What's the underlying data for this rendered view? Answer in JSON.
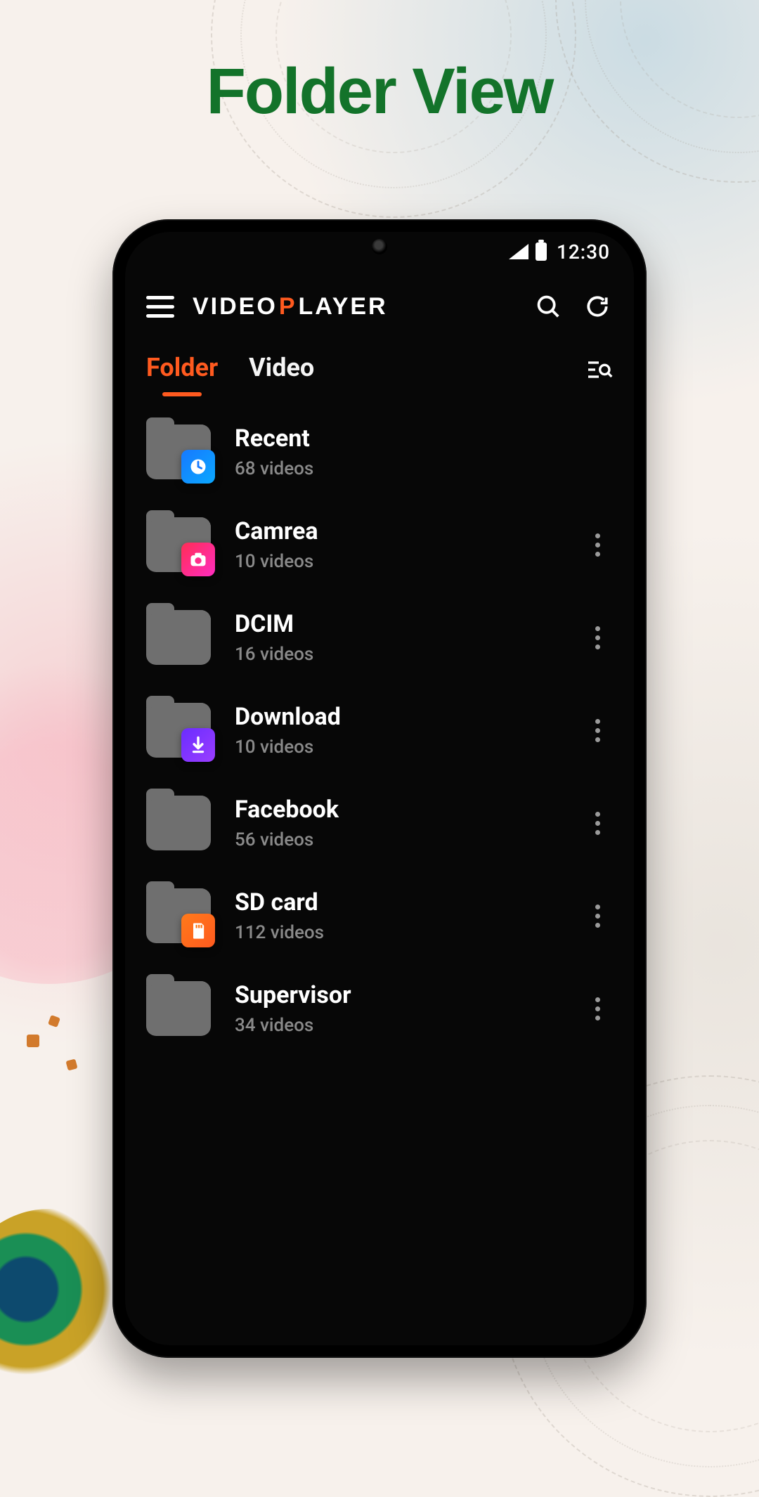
{
  "headline": "Folder View",
  "statusbar": {
    "time": "12:30"
  },
  "app": {
    "title_prefix": "VIDEO ",
    "title_accent": "P",
    "title_suffix": "LAYER"
  },
  "tabs": {
    "folder": "Folder",
    "video": "Video",
    "active": "folder"
  },
  "video_unit_suffix": " videos",
  "folders": [
    {
      "key": "recent",
      "name": "Recent",
      "count": 68,
      "badge": "clock",
      "has_more": false
    },
    {
      "key": "camera",
      "name": "Camrea",
      "count": 10,
      "badge": "camera",
      "has_more": true
    },
    {
      "key": "dcim",
      "name": "DCIM",
      "count": 16,
      "badge": null,
      "has_more": true
    },
    {
      "key": "download",
      "name": "Download",
      "count": 10,
      "badge": "download",
      "has_more": true
    },
    {
      "key": "facebook",
      "name": "Facebook",
      "count": 56,
      "badge": null,
      "has_more": true
    },
    {
      "key": "sdcard",
      "name": "SD card",
      "count": 112,
      "badge": "sd",
      "has_more": true
    },
    {
      "key": "supervisor",
      "name": "Supervisor",
      "count": 34,
      "badge": null,
      "has_more": true
    }
  ]
}
